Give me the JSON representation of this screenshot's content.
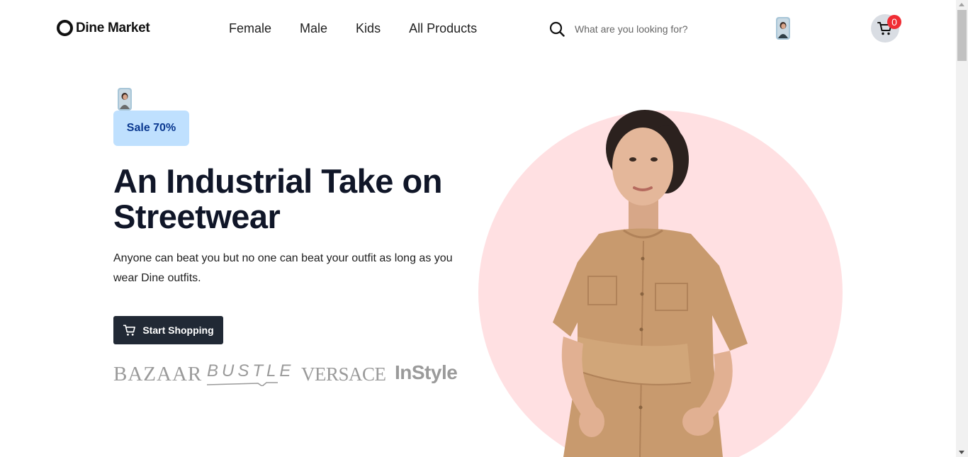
{
  "header": {
    "logo_text": "Dine Market",
    "nav": [
      "Female",
      "Male",
      "Kids",
      "All Products"
    ],
    "search_placeholder": "What are you looking for?",
    "cart_count": "0"
  },
  "hero": {
    "badge": "Sale 70%",
    "title": "An Industrial Take on Streetwear",
    "description": "Anyone can beat you but no one can beat your outfit as long as you wear Dine outfits.",
    "cta_label": "Start Shopping",
    "brands": [
      "BAZAAR",
      "BUSTLE",
      "VERSACE",
      "InStyle"
    ]
  },
  "colors": {
    "badge_bg": "#bfe0fe",
    "badge_text": "#0a3890",
    "cta_bg": "#212935",
    "circle_bg": "#ffe0e2",
    "cart_bg": "#d9dde3",
    "cart_badge": "#f02d34"
  },
  "icons": [
    "logo-ring-icon",
    "search-icon",
    "cart-icon",
    "shopping-cart-icon"
  ]
}
